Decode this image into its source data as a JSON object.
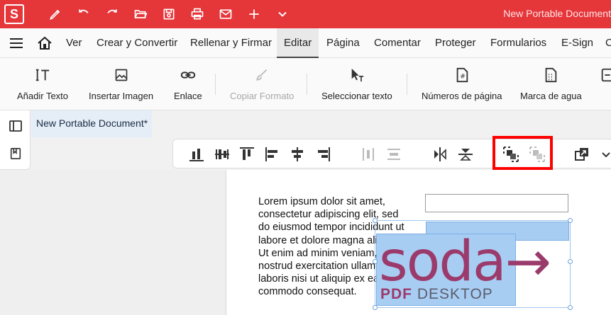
{
  "app": {
    "logo_letter": "S",
    "window_title": "New Portable Document"
  },
  "quick_access": [
    "pen-icon",
    "undo-icon",
    "redo-icon",
    "open-folder-icon",
    "save-icon",
    "print-icon",
    "mail-icon",
    "plus-icon",
    "chevron-down-icon"
  ],
  "menu": {
    "items": [
      "Ver",
      "Crear y Convertir",
      "Rellenar y Firmar",
      "Editar",
      "Página",
      "Comentar",
      "Proteger",
      "Formularios",
      "E-Sign",
      "C"
    ],
    "active": "Editar"
  },
  "ribbon": {
    "items": [
      "Añadir Texto",
      "Insertar Imagen",
      "Enlace",
      "Copiar Formato",
      "Seleccionar texto",
      "Números de página",
      "Marca de agua"
    ],
    "disabled": [
      "Copiar Formato"
    ]
  },
  "document": {
    "tab_title": "New Portable Document*",
    "paragraph": "Lorem ipsum dolor sit amet,\nconsectetur adipiscing elit, sed\ndo eiusmod tempor incididunt ut\nlabore et dolore magna aliqua.\nUt enim ad minim veniam, quis\nnostrud exercitation ullamco\nlaboris nisi ut aliquip ex ea\ncommodo consequat.",
    "logo_main": "soda→",
    "logo_sub_bold": "PDF",
    "logo_sub_rest": " DESKTOP"
  },
  "colors": {
    "titlebar": "#e5363a",
    "selection": "#a8cdf3",
    "highlight": "#ff0000",
    "brand": "#9b3b6b"
  }
}
